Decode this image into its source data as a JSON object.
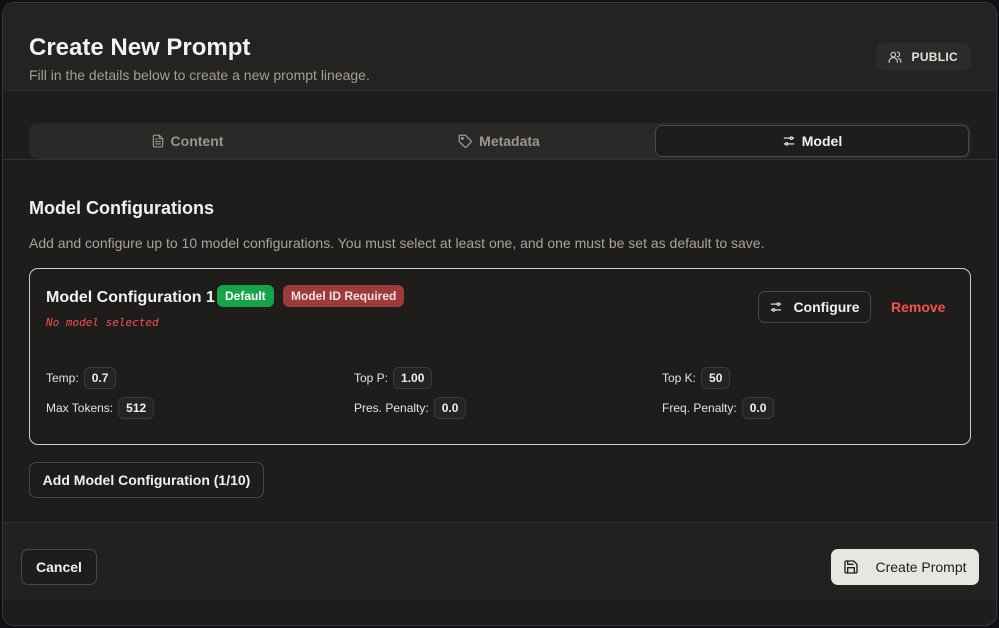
{
  "header": {
    "title": "Create New Prompt",
    "subtitle": "Fill in the details below to create a new prompt lineage.",
    "visibility_badge": "PUBLIC"
  },
  "tabs": [
    {
      "label": "Content",
      "icon": "document-icon",
      "active": false
    },
    {
      "label": "Metadata",
      "icon": "tag-icon",
      "active": false
    },
    {
      "label": "Model",
      "icon": "sliders-icon",
      "active": true
    }
  ],
  "section": {
    "title": "Model Configurations",
    "description": "Add and configure up to 10 model configurations. You must select at least one, and one must be set as default to save."
  },
  "config_card": {
    "title": "Model Configuration 1",
    "default_badge": "Default",
    "required_badge": "Model ID Required",
    "no_model_text": "No model selected",
    "configure_label": "Configure",
    "remove_label": "Remove",
    "params": {
      "temp": {
        "label": "Temp:",
        "value": "0.7"
      },
      "top_p": {
        "label": "Top P:",
        "value": "1.00"
      },
      "top_k": {
        "label": "Top K:",
        "value": "50"
      },
      "max_tokens": {
        "label": "Max Tokens:",
        "value": "512"
      },
      "pres_penalty": {
        "label": "Pres. Penalty:",
        "value": "0.0"
      },
      "freq_penalty": {
        "label": "Freq. Penalty:",
        "value": "0.0"
      }
    }
  },
  "add_config_label": "Add Model Configuration (1/10)",
  "footer": {
    "cancel_label": "Cancel",
    "create_label": "Create Prompt"
  },
  "colors": {
    "accent_default": "#16a34a",
    "accent_required": "#9b3b3b",
    "danger": "#f05252"
  }
}
